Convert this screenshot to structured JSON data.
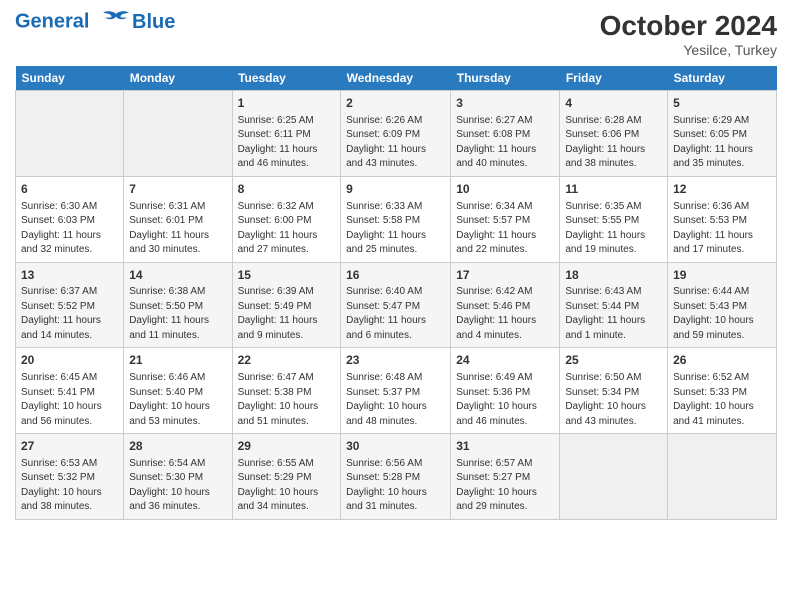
{
  "header": {
    "logo_line1": "General",
    "logo_line2": "Blue",
    "month": "October 2024",
    "location": "Yesilce, Turkey"
  },
  "days_of_week": [
    "Sunday",
    "Monday",
    "Tuesday",
    "Wednesday",
    "Thursday",
    "Friday",
    "Saturday"
  ],
  "weeks": [
    [
      {
        "day": "",
        "empty": true
      },
      {
        "day": "",
        "empty": true
      },
      {
        "day": "1",
        "sunrise": "6:25 AM",
        "sunset": "6:11 PM",
        "daylight": "11 hours and 46 minutes."
      },
      {
        "day": "2",
        "sunrise": "6:26 AM",
        "sunset": "6:09 PM",
        "daylight": "11 hours and 43 minutes."
      },
      {
        "day": "3",
        "sunrise": "6:27 AM",
        "sunset": "6:08 PM",
        "daylight": "11 hours and 40 minutes."
      },
      {
        "day": "4",
        "sunrise": "6:28 AM",
        "sunset": "6:06 PM",
        "daylight": "11 hours and 38 minutes."
      },
      {
        "day": "5",
        "sunrise": "6:29 AM",
        "sunset": "6:05 PM",
        "daylight": "11 hours and 35 minutes."
      }
    ],
    [
      {
        "day": "6",
        "sunrise": "6:30 AM",
        "sunset": "6:03 PM",
        "daylight": "11 hours and 32 minutes."
      },
      {
        "day": "7",
        "sunrise": "6:31 AM",
        "sunset": "6:01 PM",
        "daylight": "11 hours and 30 minutes."
      },
      {
        "day": "8",
        "sunrise": "6:32 AM",
        "sunset": "6:00 PM",
        "daylight": "11 hours and 27 minutes."
      },
      {
        "day": "9",
        "sunrise": "6:33 AM",
        "sunset": "5:58 PM",
        "daylight": "11 hours and 25 minutes."
      },
      {
        "day": "10",
        "sunrise": "6:34 AM",
        "sunset": "5:57 PM",
        "daylight": "11 hours and 22 minutes."
      },
      {
        "day": "11",
        "sunrise": "6:35 AM",
        "sunset": "5:55 PM",
        "daylight": "11 hours and 19 minutes."
      },
      {
        "day": "12",
        "sunrise": "6:36 AM",
        "sunset": "5:53 PM",
        "daylight": "11 hours and 17 minutes."
      }
    ],
    [
      {
        "day": "13",
        "sunrise": "6:37 AM",
        "sunset": "5:52 PM",
        "daylight": "11 hours and 14 minutes."
      },
      {
        "day": "14",
        "sunrise": "6:38 AM",
        "sunset": "5:50 PM",
        "daylight": "11 hours and 11 minutes."
      },
      {
        "day": "15",
        "sunrise": "6:39 AM",
        "sunset": "5:49 PM",
        "daylight": "11 hours and 9 minutes."
      },
      {
        "day": "16",
        "sunrise": "6:40 AM",
        "sunset": "5:47 PM",
        "daylight": "11 hours and 6 minutes."
      },
      {
        "day": "17",
        "sunrise": "6:42 AM",
        "sunset": "5:46 PM",
        "daylight": "11 hours and 4 minutes."
      },
      {
        "day": "18",
        "sunrise": "6:43 AM",
        "sunset": "5:44 PM",
        "daylight": "11 hours and 1 minute."
      },
      {
        "day": "19",
        "sunrise": "6:44 AM",
        "sunset": "5:43 PM",
        "daylight": "10 hours and 59 minutes."
      }
    ],
    [
      {
        "day": "20",
        "sunrise": "6:45 AM",
        "sunset": "5:41 PM",
        "daylight": "10 hours and 56 minutes."
      },
      {
        "day": "21",
        "sunrise": "6:46 AM",
        "sunset": "5:40 PM",
        "daylight": "10 hours and 53 minutes."
      },
      {
        "day": "22",
        "sunrise": "6:47 AM",
        "sunset": "5:38 PM",
        "daylight": "10 hours and 51 minutes."
      },
      {
        "day": "23",
        "sunrise": "6:48 AM",
        "sunset": "5:37 PM",
        "daylight": "10 hours and 48 minutes."
      },
      {
        "day": "24",
        "sunrise": "6:49 AM",
        "sunset": "5:36 PM",
        "daylight": "10 hours and 46 minutes."
      },
      {
        "day": "25",
        "sunrise": "6:50 AM",
        "sunset": "5:34 PM",
        "daylight": "10 hours and 43 minutes."
      },
      {
        "day": "26",
        "sunrise": "6:52 AM",
        "sunset": "5:33 PM",
        "daylight": "10 hours and 41 minutes."
      }
    ],
    [
      {
        "day": "27",
        "sunrise": "6:53 AM",
        "sunset": "5:32 PM",
        "daylight": "10 hours and 38 minutes."
      },
      {
        "day": "28",
        "sunrise": "6:54 AM",
        "sunset": "5:30 PM",
        "daylight": "10 hours and 36 minutes."
      },
      {
        "day": "29",
        "sunrise": "6:55 AM",
        "sunset": "5:29 PM",
        "daylight": "10 hours and 34 minutes."
      },
      {
        "day": "30",
        "sunrise": "6:56 AM",
        "sunset": "5:28 PM",
        "daylight": "10 hours and 31 minutes."
      },
      {
        "day": "31",
        "sunrise": "6:57 AM",
        "sunset": "5:27 PM",
        "daylight": "10 hours and 29 minutes."
      },
      {
        "day": "",
        "empty": true
      },
      {
        "day": "",
        "empty": true
      }
    ]
  ],
  "labels": {
    "sunrise": "Sunrise:",
    "sunset": "Sunset:",
    "daylight": "Daylight:"
  }
}
